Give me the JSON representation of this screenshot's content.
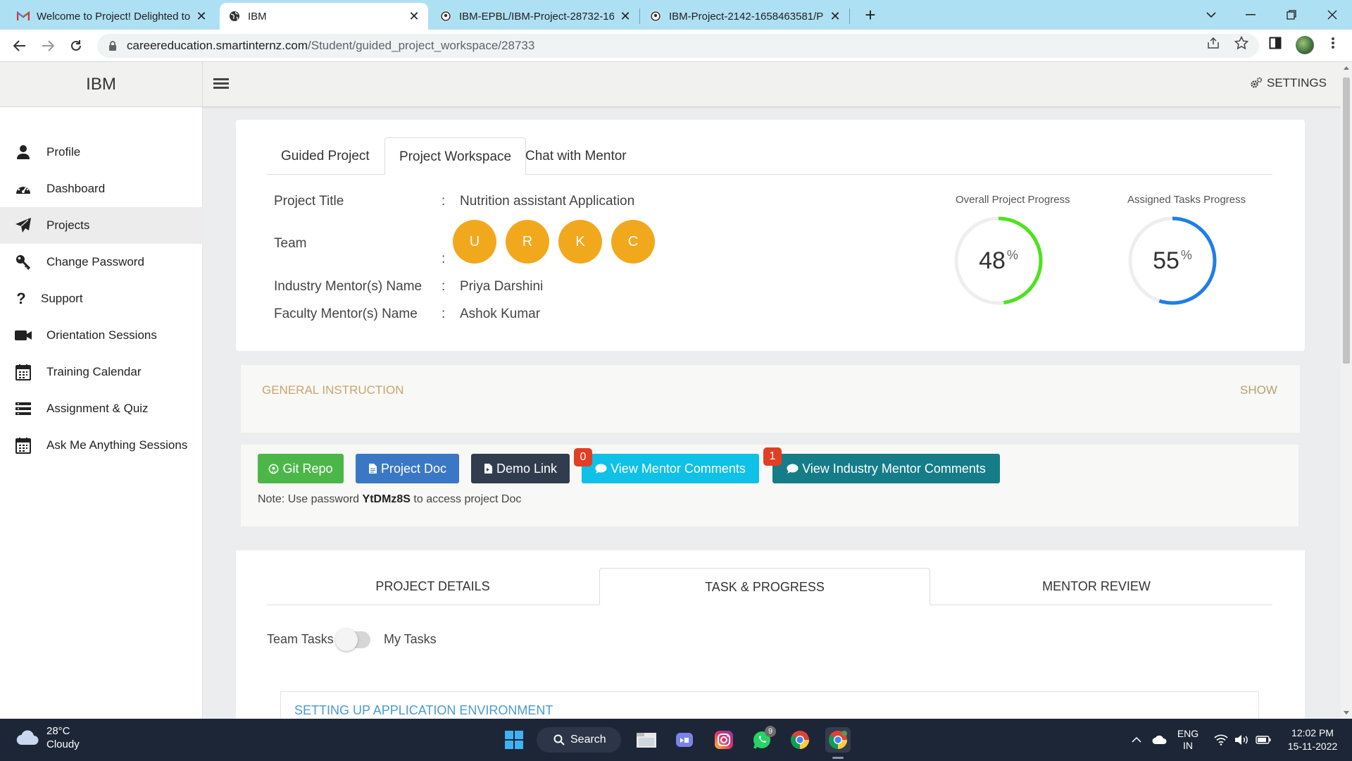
{
  "browser": {
    "tabs": [
      {
        "title": "Welcome to Project! Delighted to",
        "icon": "gmail-icon"
      },
      {
        "title": "IBM",
        "icon": "globe-icon"
      },
      {
        "title": "IBM-EPBL/IBM-Project-28732-16",
        "icon": "github-icon"
      },
      {
        "title": "IBM-Project-2142-1658463581/P",
        "icon": "github-icon"
      }
    ],
    "url_host": "careereducation.smartinternz.com",
    "url_path": "/Student/guided_project_workspace/28733"
  },
  "header": {
    "brand": "IBM",
    "settings_label": "SETTINGS"
  },
  "sidebar": {
    "items": [
      {
        "label": "Profile",
        "icon": "user-icon"
      },
      {
        "label": "Dashboard",
        "icon": "dashboard-icon"
      },
      {
        "label": "Projects",
        "icon": "paper-plane-icon"
      },
      {
        "label": "Change Password",
        "icon": "key-icon"
      },
      {
        "label": "Support",
        "icon": "question-icon"
      },
      {
        "label": "Orientation Sessions",
        "icon": "video-icon"
      },
      {
        "label": "Training Calendar",
        "icon": "calendar-icon"
      },
      {
        "label": "Assignment & Quiz",
        "icon": "list-icon"
      },
      {
        "label": "Ask Me Anything Sessions",
        "icon": "calendar-icon"
      }
    ]
  },
  "top_tabs": [
    "Guided Project",
    "Project Workspace",
    "Chat with Mentor"
  ],
  "project": {
    "title_label": "Project Title",
    "title_value": "Nutrition assistant Application",
    "team_label": "Team",
    "team_members": [
      "U",
      "R",
      "K",
      "C"
    ],
    "industry_mentor_label": "Industry Mentor(s) Name",
    "industry_mentor_value": "Priya Darshini",
    "faculty_mentor_label": "Faculty Mentor(s) Name",
    "faculty_mentor_value": "Ashok Kumar",
    "colon": ":"
  },
  "progress": {
    "overall_label": "Overall Project Progress",
    "overall_value": 48,
    "overall_color": "#4ce31c",
    "assigned_label": "Assigned Tasks Progress",
    "assigned_value": 55,
    "assigned_color": "#1f7ee8",
    "percent_sign": "%"
  },
  "general_instruction": {
    "title": "GENERAL INSTRUCTION",
    "toggle": "SHOW"
  },
  "actions": {
    "git_repo": "Git Repo",
    "project_doc": "Project Doc",
    "demo_link": "Demo Link",
    "mentor_comments": "View Mentor Comments",
    "mentor_comments_count": "0",
    "industry_comments": "View Industry Mentor Comments",
    "industry_comments_count": "1",
    "note_prefix": "Note: Use password",
    "note_password": "YtDMz8S",
    "note_suffix": "to access project Doc"
  },
  "bottom_tabs": [
    "PROJECT DETAILS",
    "TASK & PROGRESS",
    "MENTOR REVIEW"
  ],
  "tasks": {
    "team_tasks_label": "Team Tasks",
    "my_tasks_label": "My Tasks",
    "section_title": "SETTING UP APPLICATION ENVIRONMENT"
  },
  "taskbar": {
    "temperature": "28°C",
    "weather": "Cloudy",
    "search_label": "Search",
    "whatsapp_badge": "9",
    "language": "ENG",
    "region": "IN",
    "time": "12:02 PM",
    "date": "15-11-2022"
  }
}
